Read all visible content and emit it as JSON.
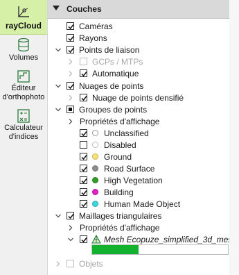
{
  "sidebar": {
    "items": [
      {
        "label": "rayCloud",
        "icon": "raycloud-icon",
        "active": true
      },
      {
        "label": "Volumes",
        "icon": "volumes-icon"
      },
      {
        "label": "Éditeur d'orthophoto",
        "line1": "Éditeur",
        "line2": "d'orthophoto",
        "icon": "ortho-editor-icon"
      },
      {
        "label": "Calculateur d'indices",
        "line1": "Calculateur",
        "line2": "d'indices",
        "icon": "index-calculator-icon"
      }
    ]
  },
  "panel": {
    "title": "Couches",
    "tree": [
      {
        "label": "Caméras"
      },
      {
        "label": "Rayons"
      },
      {
        "label": "Points de liaison"
      },
      {
        "label": "GCPs / MTPs"
      },
      {
        "label": "Automatique"
      },
      {
        "label": "Nuages de points"
      },
      {
        "label": "Nuage de points densifié"
      },
      {
        "label": "Groupes de points"
      },
      {
        "label": "Propriétés d'affichage"
      },
      {
        "label": "Unclassified",
        "color": "#ffffff"
      },
      {
        "label": "Disabled",
        "color": "#ffffff"
      },
      {
        "label": "Ground",
        "color": "#f5e27a"
      },
      {
        "label": "Road Surface",
        "color": "#8c8c8c"
      },
      {
        "label": "High Vegetation",
        "color": "#2f9e25"
      },
      {
        "label": "Building",
        "color": "#e020c8"
      },
      {
        "label": "Human Made Object",
        "color": "#3fd7df"
      },
      {
        "label": "Maillages triangulaires"
      },
      {
        "label": "Propriétés d'affichage"
      },
      {
        "label": "Mesh Ecopuze_simplified_3d_mes"
      },
      {
        "label": "Objets"
      }
    ],
    "mesh_progress": 0.34
  }
}
